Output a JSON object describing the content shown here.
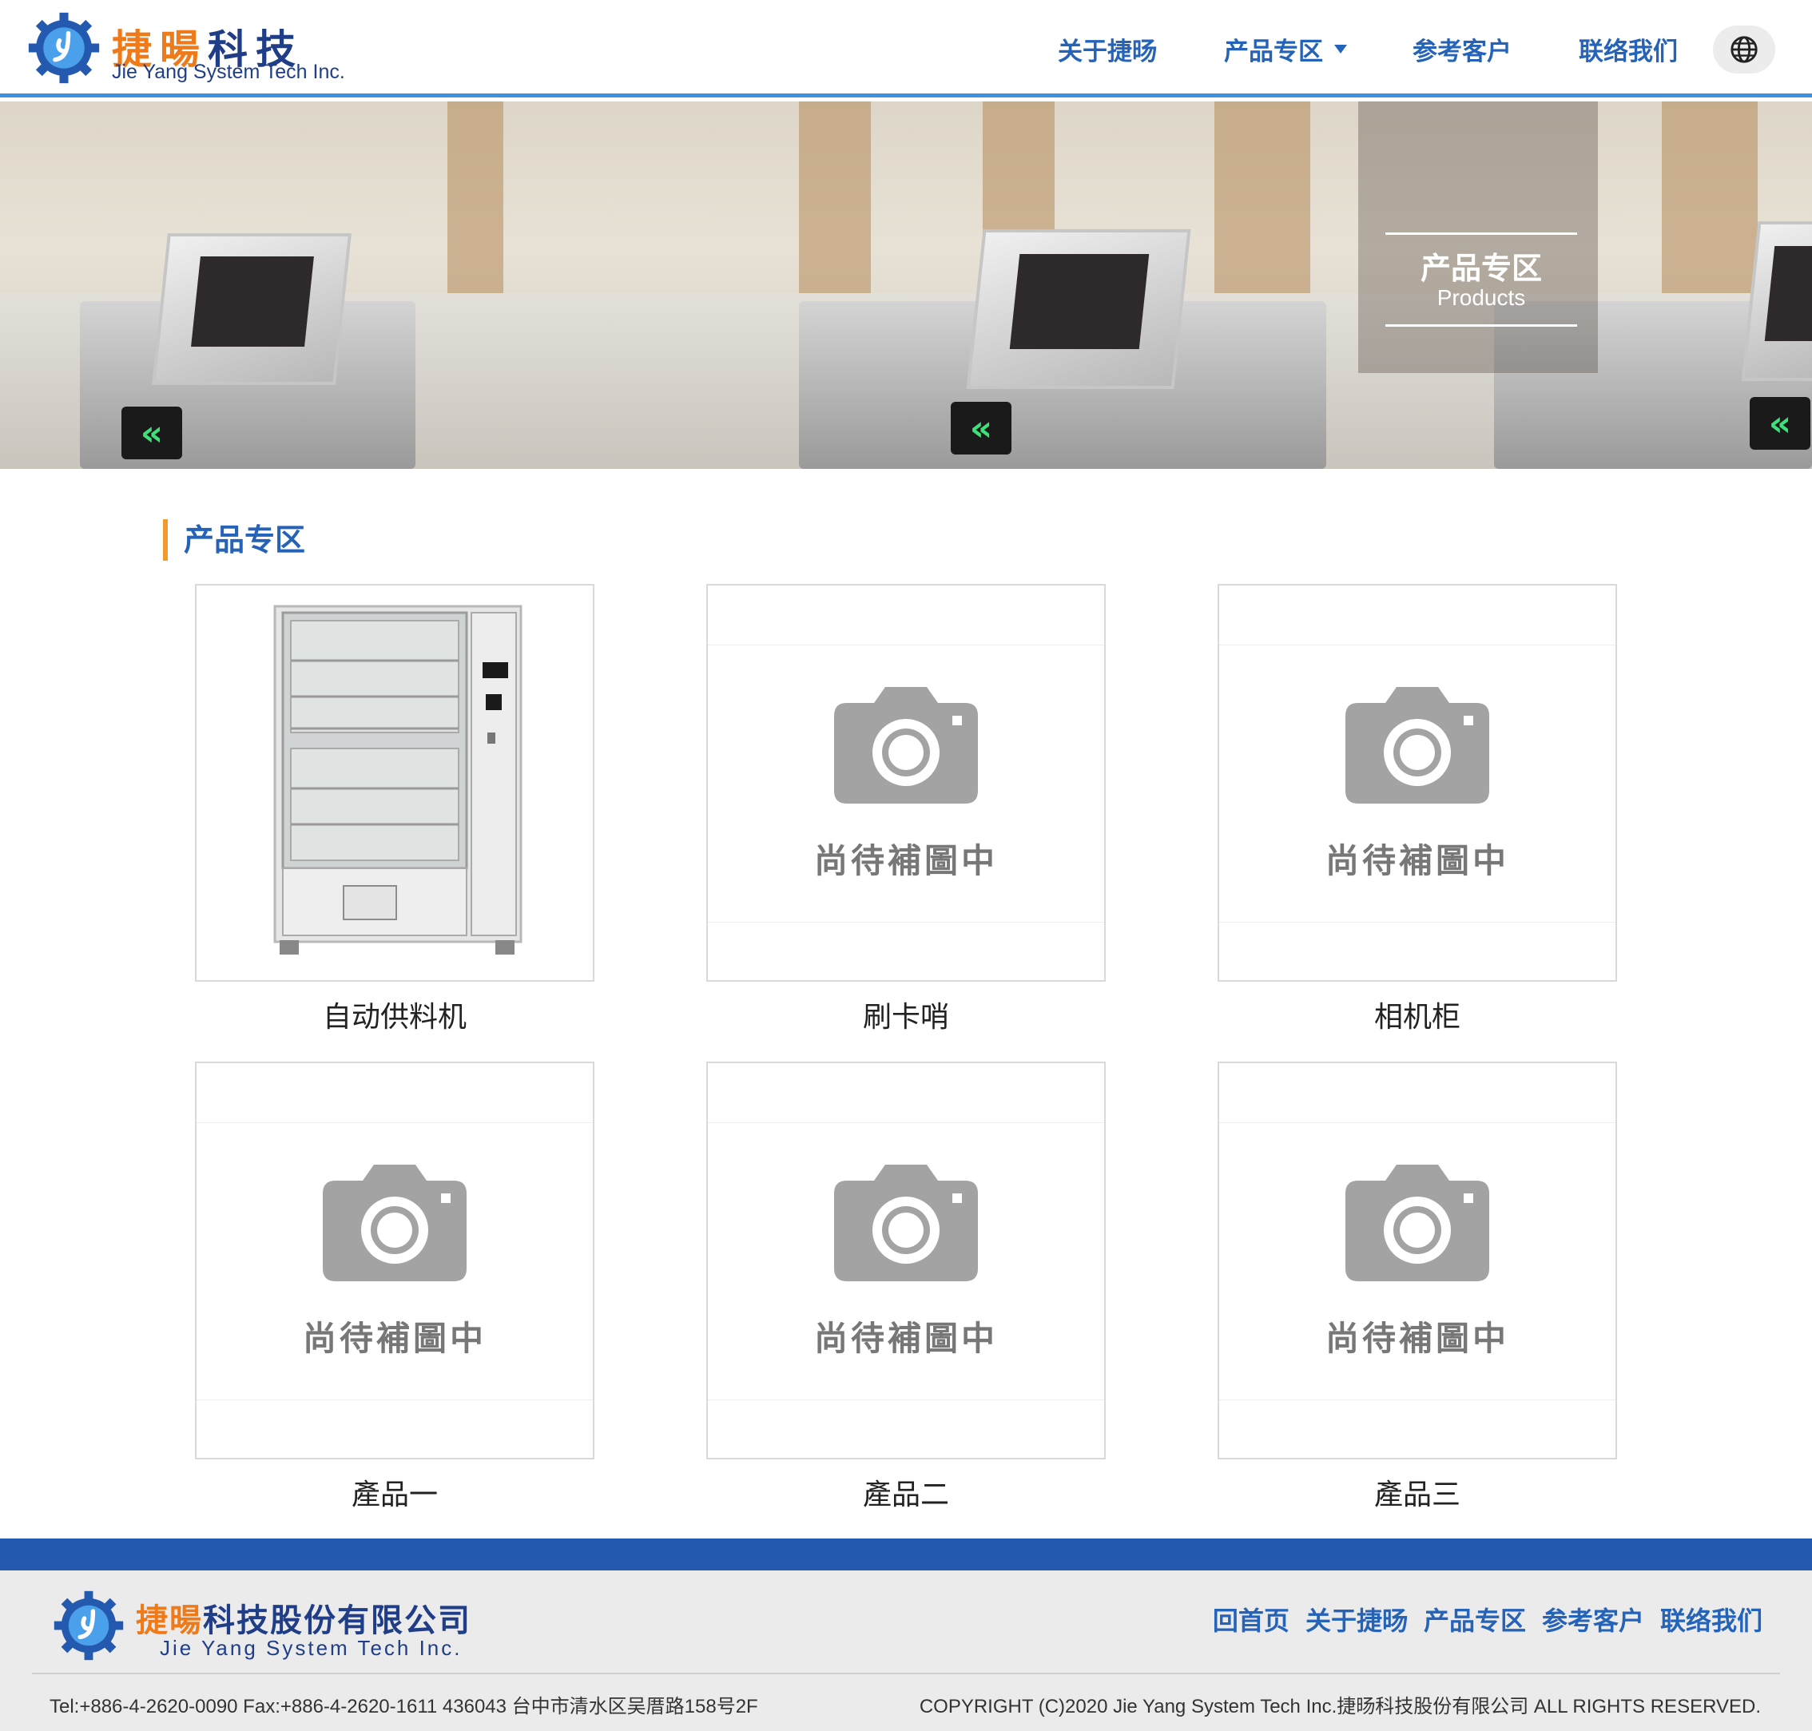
{
  "brand": {
    "name_cn_orange": "捷暘",
    "name_cn_navy": "科技",
    "name_en": "Jie Yang System Tech Inc.",
    "accent_orange": "#ee7a1a",
    "navy": "#1f3e87",
    "link_blue": "#2563b8"
  },
  "nav": {
    "about": "关于捷旸",
    "products": "产品专区",
    "clients": "参考客户",
    "contact": "联络我们",
    "language_icon": "globe-icon"
  },
  "banner": {
    "title_cn": "产品专区",
    "title_en": "Products"
  },
  "section": {
    "title": "产品专区"
  },
  "products": [
    {
      "name": "自动供料机",
      "has_image": true
    },
    {
      "name": "刷卡哨",
      "has_image": false,
      "placeholder": "尚待補圖中"
    },
    {
      "name": "相机柜",
      "has_image": false,
      "placeholder": "尚待補圖中"
    },
    {
      "name": "產品一",
      "has_image": false,
      "placeholder": "尚待補圖中"
    },
    {
      "name": "產品二",
      "has_image": false,
      "placeholder": "尚待補圖中"
    },
    {
      "name": "產品三",
      "has_image": false,
      "placeholder": "尚待補圖中"
    }
  ],
  "footer": {
    "company_cn_orange": "捷暘",
    "company_cn_navy": "科技股份有限公司",
    "company_en": "Jie Yang System Tech Inc.",
    "links": [
      "回首页",
      "关于捷旸",
      "产品专区",
      "参考客户",
      "联络我们"
    ],
    "contact": "Tel:+886-4-2620-0090 Fax:+886-4-2620-1611 436043 台中市清水区吴厝路158号2F",
    "copyright": "COPYRIGHT (C)2020 Jie Yang System Tech Inc.捷旸科技股份有限公司 ALL RIGHTS RESERVED."
  }
}
